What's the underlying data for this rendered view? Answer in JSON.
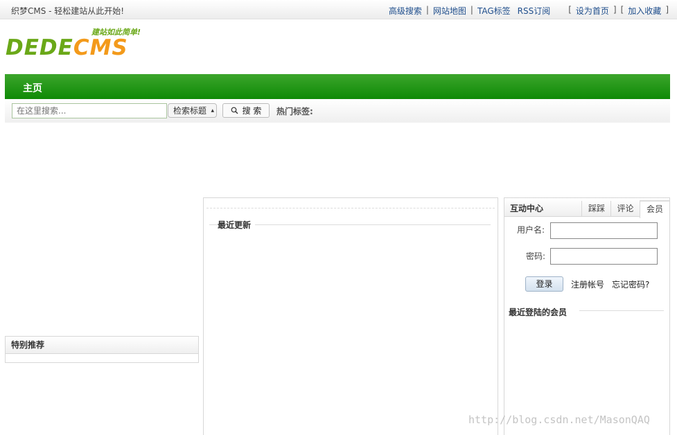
{
  "topbar": {
    "slogan": "织梦CMS - 轻松建站从此开始!",
    "links": [
      "高级搜索",
      "网站地图",
      "TAG标签",
      "RSS订阅"
    ],
    "separator": "|",
    "set_home": "设为首页",
    "add_fav": "加入收藏",
    "bracket_open": "[",
    "bracket_close": "]"
  },
  "logo": {
    "text_dede": "DEDE",
    "text_cms": "CMS",
    "tagline": "建站如此简单!",
    "brand_green": "#6aa818",
    "brand_orange": "#f39a1b"
  },
  "nav": {
    "home": "主页",
    "bar_color": "#0e8a05"
  },
  "search": {
    "placeholder": "在这里搜索...",
    "select_value": "检索标题",
    "button_label": "搜 索",
    "hot_tags_label": "热门标签:",
    "icon": "search-icon"
  },
  "left": {
    "special_title": "特别推荐"
  },
  "center": {
    "recent_title": "最近更新"
  },
  "right": {
    "header": "互动中心",
    "tabs": [
      "踩踩",
      "评论",
      "会员"
    ],
    "active_tab": "会员",
    "username_label": "用户名:",
    "password_label": "密码:",
    "login_button": "登录",
    "register_link": "注册帐号",
    "forgot_link": "忘记密码?",
    "recent_members": "最近登陆的会员"
  },
  "watermark": "http://blog.csdn.net/MasonQAQ"
}
